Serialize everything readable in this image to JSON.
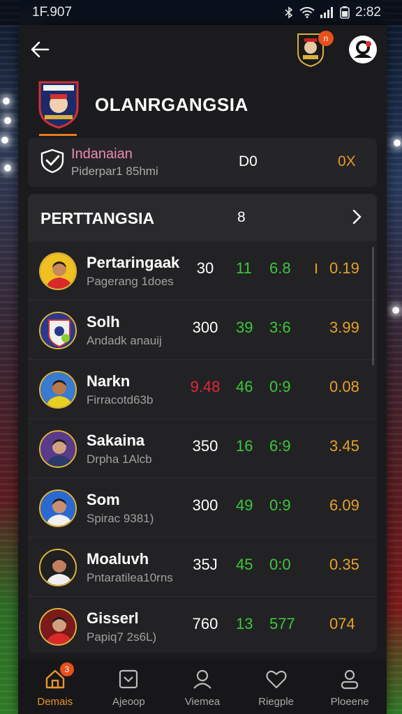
{
  "status_bar": {
    "time": "1F.907",
    "clock": "2:82"
  },
  "header": {
    "notification_count": "n"
  },
  "club": {
    "name": "OLANRGANGSIA"
  },
  "summary": {
    "title": "Indanaian",
    "subtitle": "Piderpar1 85hmi",
    "mid_value": "D0",
    "right_value": "0X"
  },
  "table": {
    "title": "PERTTANGSIA",
    "column_label": "8",
    "rows": [
      {
        "name": "Pertaringaak",
        "sub": "Pagerang 1does",
        "v1": "30",
        "v2": "11",
        "v3": "6.8",
        "v4": "0.19",
        "v1_red": false,
        "mark": true
      },
      {
        "name": "Solh",
        "sub": "Andadk anauij",
        "v1": "300",
        "v2": "39",
        "v3": "3:6",
        "v4": "3.99",
        "v1_red": false,
        "mark": false
      },
      {
        "name": "Narkn",
        "sub": "Firracotd63b",
        "v1": "9.48",
        "v2": "46",
        "v3": "0:9",
        "v4": "0.08",
        "v1_red": true,
        "mark": false
      },
      {
        "name": "Sakaina",
        "sub": "Drpha 1Alcb",
        "v1": "350",
        "v2": "16",
        "v3": "6:9",
        "v4": "3.45",
        "v1_red": false,
        "mark": false
      },
      {
        "name": "Som",
        "sub": "Spirac 9381)",
        "v1": "300",
        "v2": "49",
        "v3": "0:9",
        "v4": "6.09",
        "v1_red": false,
        "mark": false
      },
      {
        "name": "Moaluvh",
        "sub": "Pntaratilea10rns",
        "v1": "35J",
        "v2": "45",
        "v3": "0:0",
        "v4": "0.35",
        "v1_red": false,
        "mark": false
      },
      {
        "name": "Gisserl",
        "sub": "Papiq7 2s6L)",
        "v1": "760",
        "v2": "13",
        "v3": "577",
        "v4": "074",
        "v1_red": false,
        "mark": false
      }
    ]
  },
  "nav": {
    "badge": "3",
    "items": [
      {
        "label": "Demais",
        "icon": "home-icon"
      },
      {
        "label": "Ajeoop",
        "icon": "stats-icon"
      },
      {
        "label": "Viemea",
        "icon": "user-icon"
      },
      {
        "label": "Riegple",
        "icon": "heart-icon"
      },
      {
        "label": "Ploeene",
        "icon": "profile-icon"
      }
    ]
  },
  "colors": {
    "accent": "#e8952c",
    "positive": "#3cc83c",
    "negative": "#e02a36",
    "highlight": "#f08cb0"
  }
}
